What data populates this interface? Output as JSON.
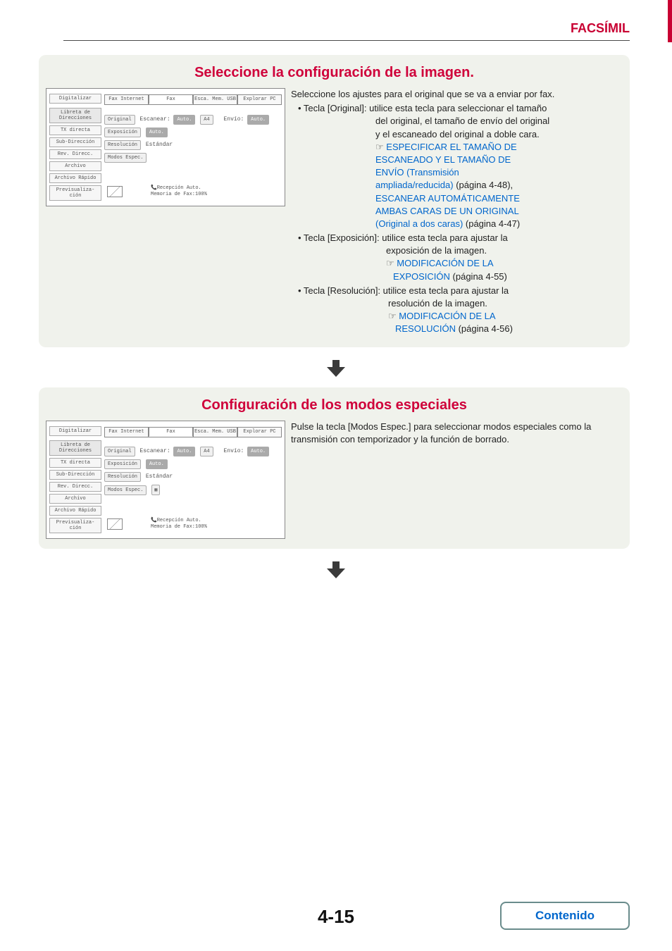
{
  "header": {
    "section": "FACSÍMIL"
  },
  "page_number": "4-15",
  "contenido": "Contenido",
  "arrow_title": "down-arrow",
  "section1": {
    "title": "Seleccione la configuración de la imagen.",
    "intro": "Seleccione los ajustes para el original que se va a enviar por fax.",
    "bullets": {
      "original": {
        "label": "• Tecla [Original]:",
        "desc1": "utilice esta tecla para seleccionar el tamaño",
        "desc2": "del original, el tamaño de envío del original",
        "desc3": "y el escaneado del original a doble cara.",
        "link1a": "ESPECIFICAR EL TAMAÑO DE",
        "link1b": "ESCANEADO Y EL TAMAÑO DE",
        "link1c": "ENVÍO (Transmisión",
        "link1d": "ampliada/reducida)",
        "page1": " (página 4-48),",
        "link2a": "ESCANEAR AUTOMÁTICAMENTE",
        "link2b": "AMBAS CARAS DE UN ORIGINAL",
        "link2c": "(Original a dos caras)",
        "page2": " (página 4-47)"
      },
      "exposicion": {
        "label": "• Tecla [Exposición]:",
        "desc1": "utilice esta tecla para ajustar la",
        "desc2": "exposición de la imagen.",
        "link1a": "MODIFICACIÓN DE LA",
        "link1b": "EXPOSICIÓN",
        "page1": " (página 4-55)"
      },
      "resolucion": {
        "label": "• Tecla [Resolución]:",
        "desc1": "utilice esta tecla para ajustar la",
        "desc2": "resolución de la imagen.",
        "link1a": "MODIFICACIÓN DE LA",
        "link1b": "RESOLUCIÓN",
        "page1": " (página 4-56)"
      }
    },
    "pointer": "☞"
  },
  "section2": {
    "title": "Configuración de los modos especiales",
    "body": "Pulse la tecla [Modos Espec.] para seleccionar modos especiales como la transmisión con temporizador y la función de borrado."
  },
  "lcd": {
    "tabs": {
      "digitalizar": "Digitalizar",
      "faxinternet": "Fax Internet",
      "fax": "Fax",
      "escamemusb": "Esca. Mem. USB",
      "explorarpc": "Explorar PC"
    },
    "side": {
      "libreta": "Libreta de Direcciones",
      "txdirecta": "TX directa",
      "subdir": "Sub-Dirección",
      "revdirecc": "Rev. Direcc.",
      "archivo": "Archivo",
      "archivorapido": "Archivo Rápido",
      "previsualiza": "Previsualiza-ción"
    },
    "rows": {
      "original": "Original",
      "escanear": "Escanear:",
      "auto": "Auto.",
      "a4": "A4",
      "envio": "Envío:",
      "exposicion": "Exposición",
      "resolucion": "Resolución",
      "estandar": "Estándar",
      "modosespec": "Modos Espec."
    },
    "footer": {
      "recep": "Recepción Auto.",
      "memoria": "Memoria de Fax:100%"
    }
  }
}
